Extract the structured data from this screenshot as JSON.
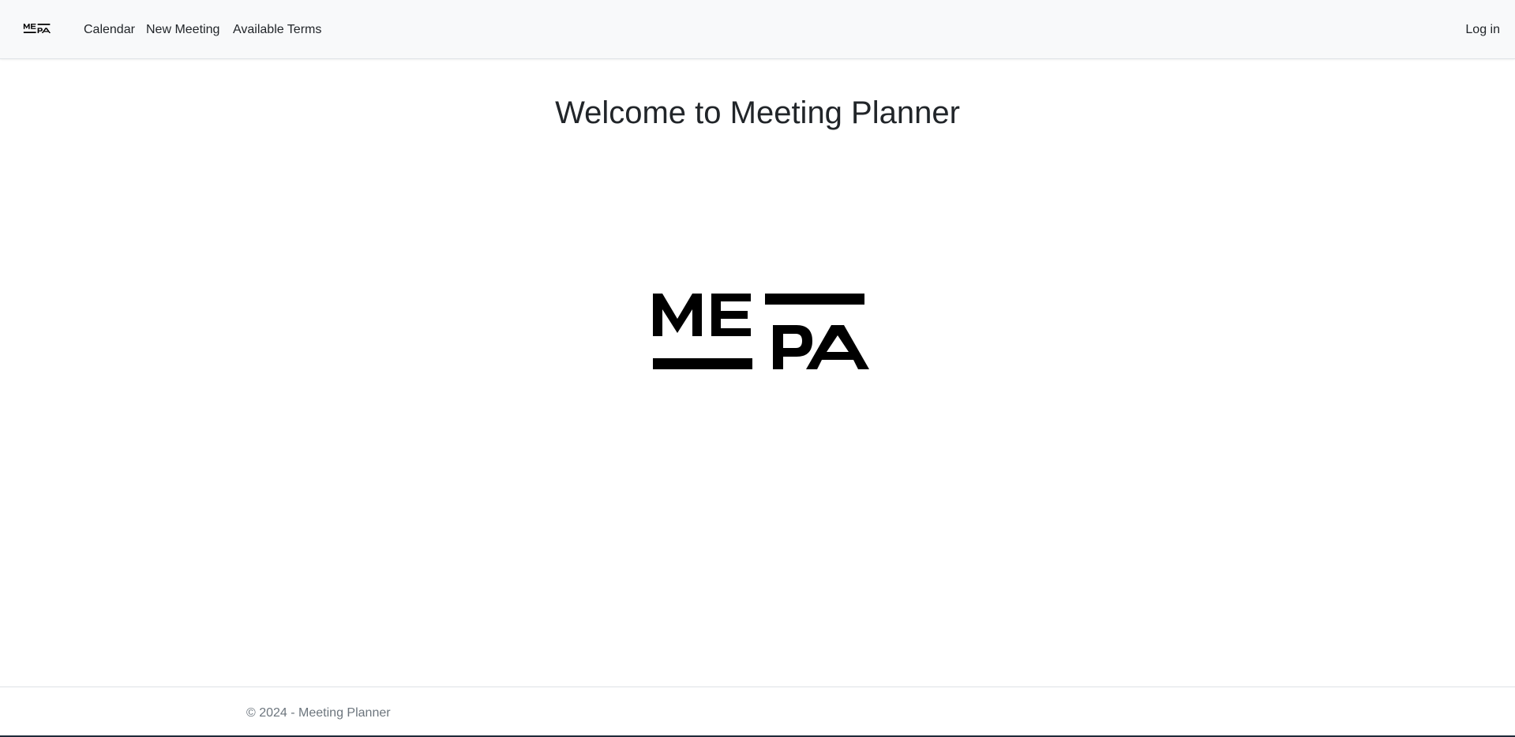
{
  "brand": {
    "logo_text": "MEPA",
    "logo_icon": "mepa-logo-icon"
  },
  "nav": {
    "items": [
      {
        "label": "Calendar"
      },
      {
        "label": "New Meeting"
      },
      {
        "label": "Available Terms"
      }
    ],
    "login_label": "Log in"
  },
  "main": {
    "title": "Welcome to Meeting Planner",
    "hero_logo_text": "MEPA"
  },
  "footer": {
    "text": "© 2024 - Meeting Planner"
  },
  "colors": {
    "navbar_bg": "#f8f9fa",
    "text": "#212529",
    "muted": "#6c757d",
    "logo": "#000000"
  }
}
